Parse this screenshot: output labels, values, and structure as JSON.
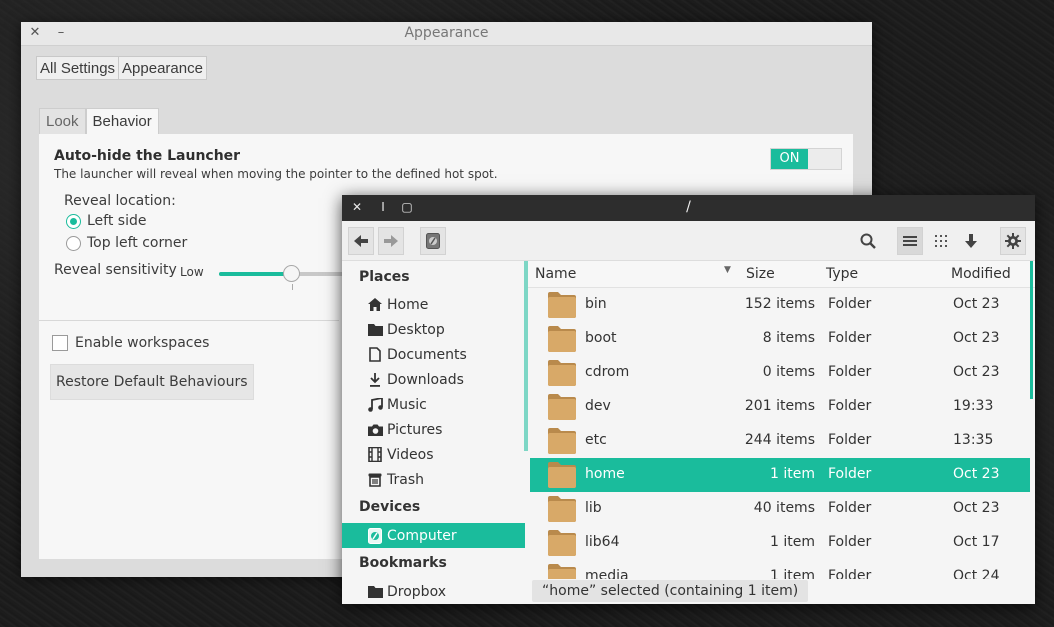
{
  "appearance": {
    "title": "Appearance",
    "breadcrumb": [
      "All Settings",
      "Appearance"
    ],
    "tabs": [
      "Look",
      "Behavior"
    ],
    "autohide_title": "Auto-hide the Launcher",
    "autohide_desc": "The launcher will reveal when moving the pointer to the defined hot spot.",
    "switch_label": "ON",
    "reveal_location_label": "Reveal location:",
    "reveal_options": [
      "Left side",
      "Top left corner"
    ],
    "reveal_selected": "Left side",
    "sensitivity_label": "Reveal sensitivity",
    "sensitivity_low": "Low",
    "sensitivity_value": 0.48,
    "enable_workspaces": "Enable workspaces",
    "restore_button": "Restore Default Behaviours",
    "close_glyph": "✕",
    "minimize_glyph": "–"
  },
  "files": {
    "title": "/",
    "titlebar_glyphs": [
      "✕",
      "I",
      "▢"
    ],
    "sidebar": {
      "places_heading": "Places",
      "places": [
        {
          "label": "Home",
          "icon": "home-icon"
        },
        {
          "label": "Desktop",
          "icon": "desktop-folder-icon"
        },
        {
          "label": "Documents",
          "icon": "document-icon"
        },
        {
          "label": "Downloads",
          "icon": "download-icon"
        },
        {
          "label": "Music",
          "icon": "music-icon"
        },
        {
          "label": "Pictures",
          "icon": "camera-icon"
        },
        {
          "label": "Videos",
          "icon": "film-icon"
        },
        {
          "label": "Trash",
          "icon": "trash-icon"
        }
      ],
      "devices_heading": "Devices",
      "devices": [
        {
          "label": "Computer",
          "icon": "drive-icon"
        }
      ],
      "bookmarks_heading": "Bookmarks",
      "bookmarks": [
        {
          "label": "Dropbox",
          "icon": "folder-icon"
        }
      ]
    },
    "columns": {
      "name": "Name",
      "size": "Size",
      "type": "Type",
      "modified": "Modified"
    },
    "rows": [
      {
        "name": "bin",
        "size": "152 items",
        "type": "Folder",
        "modified": "Oct 23"
      },
      {
        "name": "boot",
        "size": "8 items",
        "type": "Folder",
        "modified": "Oct 23"
      },
      {
        "name": "cdrom",
        "size": "0 items",
        "type": "Folder",
        "modified": "Oct 23"
      },
      {
        "name": "dev",
        "size": "201 items",
        "type": "Folder",
        "modified": "19:33"
      },
      {
        "name": "etc",
        "size": "244 items",
        "type": "Folder",
        "modified": "13:35"
      },
      {
        "name": "home",
        "size": "1 item",
        "type": "Folder",
        "modified": "Oct 23"
      },
      {
        "name": "lib",
        "size": "40 items",
        "type": "Folder",
        "modified": "Oct 23"
      },
      {
        "name": "lib64",
        "size": "1 item",
        "type": "Folder",
        "modified": "Oct 17"
      },
      {
        "name": "media",
        "size": "1 item",
        "type": "Folder",
        "modified": "Oct 24"
      }
    ],
    "selected_row": "home",
    "status": "“home” selected  (containing 1 item)"
  },
  "colors": {
    "accent": "#1abc9c",
    "folder": "#d8a968",
    "folder_dark": "#b98a4c",
    "titlebar_dark": "#2d2d2d"
  }
}
